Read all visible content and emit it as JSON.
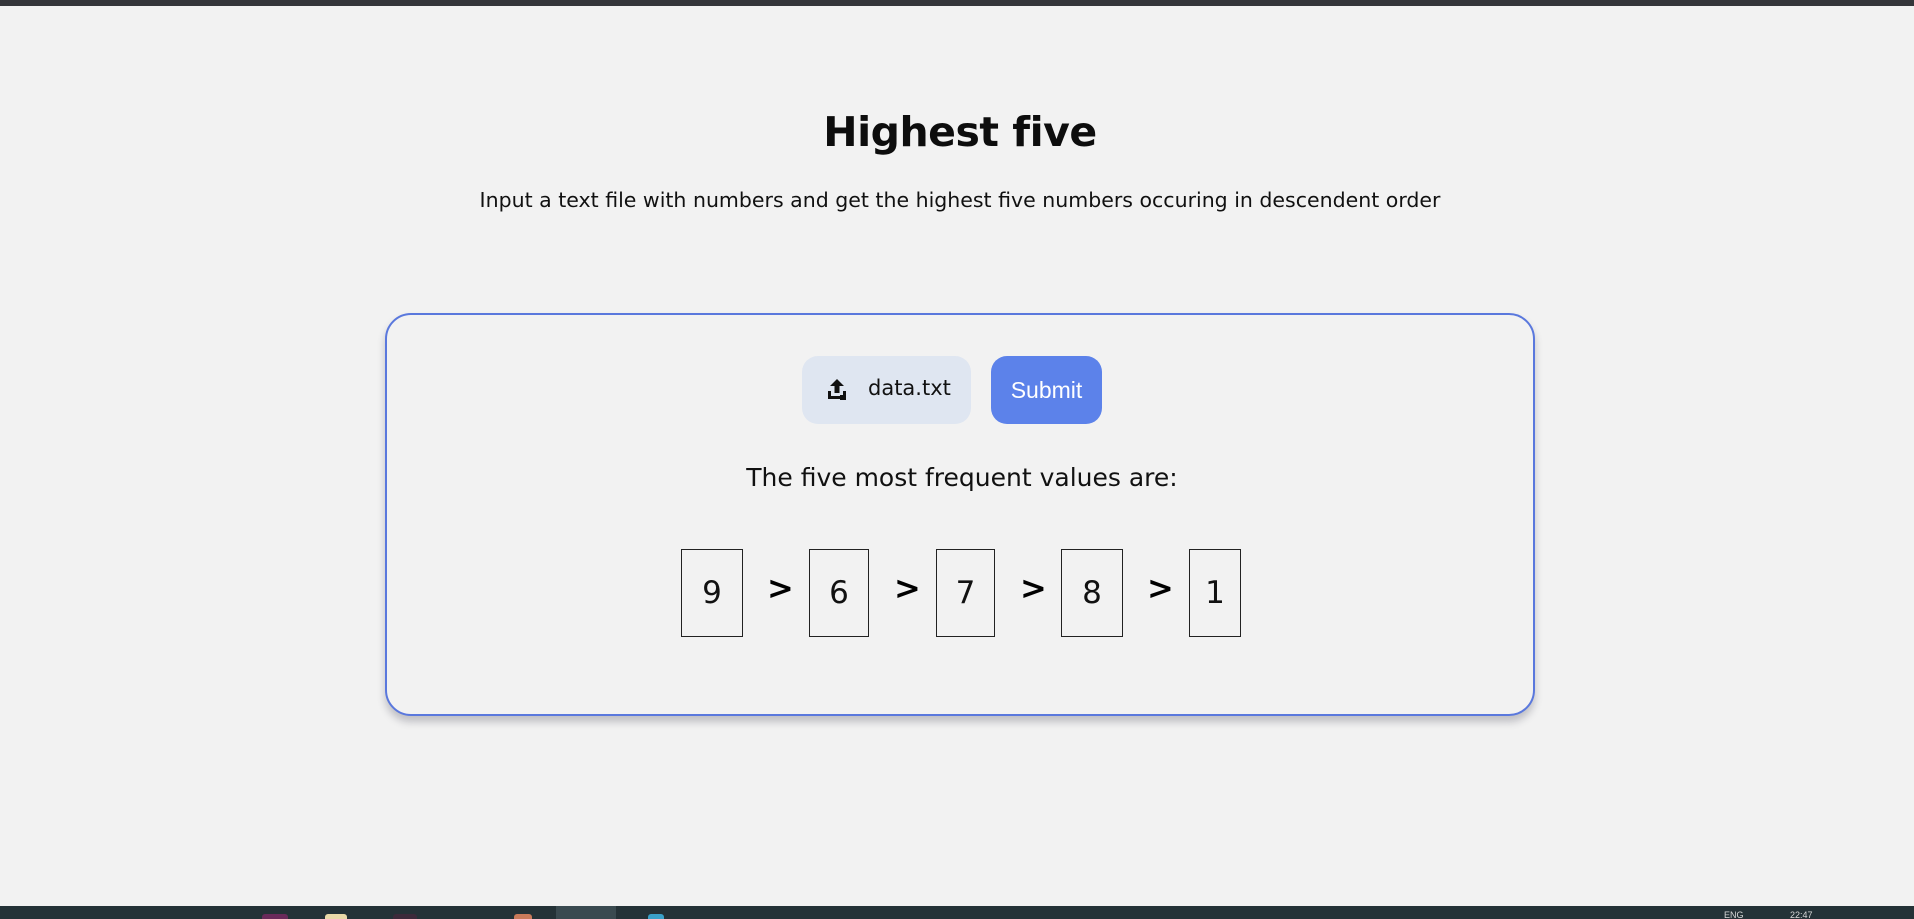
{
  "page": {
    "title": "Highest five",
    "subtitle": "Input a text file with numbers and get the highest five numbers occuring in descendent order"
  },
  "upload": {
    "icon": "upload-icon",
    "file_name": "data.txt"
  },
  "submit": {
    "label": "Submit"
  },
  "result": {
    "heading": "The five most frequent values are:",
    "values": [
      "9",
      "6",
      "7",
      "8",
      "1"
    ],
    "separator": ">"
  },
  "taskbar": {
    "language": "ENG",
    "time": "22:47"
  },
  "colors": {
    "accent": "#5c82ea",
    "card_border": "#5a78dd",
    "file_button_bg": "#dfe6f1",
    "background": "#f2f2f2"
  }
}
